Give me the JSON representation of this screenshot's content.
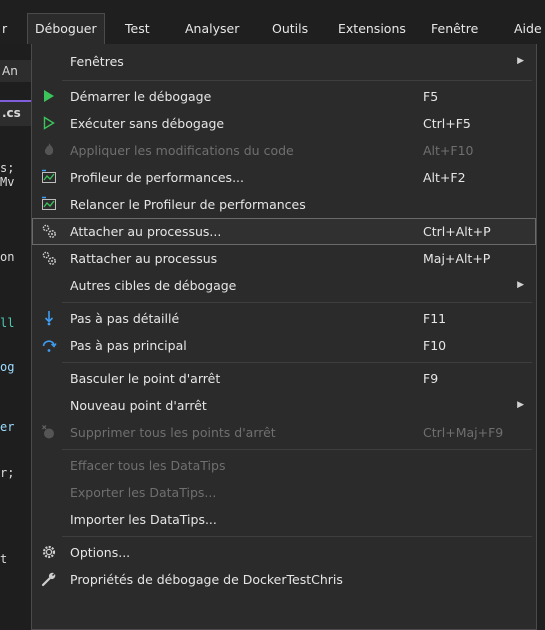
{
  "menubar": {
    "items": [
      {
        "label": "r"
      },
      {
        "label": "Déboguer"
      },
      {
        "label": "Test"
      },
      {
        "label": "Analyser"
      },
      {
        "label": "Outils"
      },
      {
        "label": "Extensions"
      },
      {
        "label": "Fenêtre"
      },
      {
        "label": "Aide"
      }
    ]
  },
  "editor": {
    "tab1": "An",
    "tab2": ".cs",
    "lines": [
      "s;",
      "Mv",
      "on",
      "ll",
      "og",
      "er",
      "r;",
      "t"
    ]
  },
  "menu": {
    "items": [
      {
        "label": "Fenêtres",
        "shortcut": "",
        "submenu": true
      },
      {
        "label": "Démarrer le débogage",
        "shortcut": "F5",
        "icon": "play-icon"
      },
      {
        "label": "Exécuter sans débogage",
        "shortcut": "Ctrl+F5",
        "icon": "play-outline-icon"
      },
      {
        "label": "Appliquer les modifications du code",
        "shortcut": "Alt+F10",
        "icon": "flame-icon",
        "disabled": true
      },
      {
        "label": "Profileur de performances...",
        "shortcut": "Alt+F2",
        "icon": "profiler-icon"
      },
      {
        "label": "Relancer le Profileur de performances",
        "shortcut": "",
        "icon": "profiler-icon"
      },
      {
        "label": "Attacher au processus...",
        "shortcut": "Ctrl+Alt+P",
        "icon": "gears-icon",
        "highlighted": true
      },
      {
        "label": "Rattacher au processus",
        "shortcut": "Maj+Alt+P",
        "icon": "gears-icon"
      },
      {
        "label": "Autres cibles de débogage",
        "shortcut": "",
        "submenu": true
      },
      {
        "label": "Pas à pas détaillé",
        "shortcut": "F11",
        "icon": "step-into-icon"
      },
      {
        "label": "Pas à pas principal",
        "shortcut": "F10",
        "icon": "step-over-icon"
      },
      {
        "label": "Basculer le point d'arrêt",
        "shortcut": "F9"
      },
      {
        "label": "Nouveau point d'arrêt",
        "shortcut": "",
        "submenu": true
      },
      {
        "label": "Supprimer tous les points d'arrêt",
        "shortcut": "Ctrl+Maj+F9",
        "icon": "delete-breakpoints-icon",
        "disabled": true
      },
      {
        "label": "Effacer tous les DataTips",
        "shortcut": "",
        "disabled": true
      },
      {
        "label": "Exporter les DataTips...",
        "shortcut": "",
        "disabled": true
      },
      {
        "label": "Importer les DataTips...",
        "shortcut": ""
      },
      {
        "label": "Options...",
        "shortcut": "",
        "icon": "settings-gear-icon"
      },
      {
        "label": "Propriétés de débogage de DockerTestChris",
        "shortcut": "",
        "icon": "wrench-icon"
      }
    ]
  },
  "colors": {
    "accent_green": "#3cc35b",
    "accent_blue": "#3f9cf0",
    "menu_bg": "#2b2b2b",
    "highlight_border": "#6a6a6a",
    "editor_tab_accent": "#7f5fdc"
  }
}
